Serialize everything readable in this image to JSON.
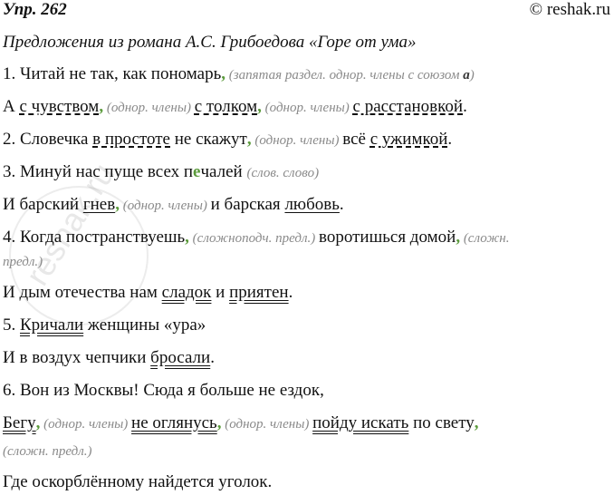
{
  "header": {
    "exercise": "Упр. 262",
    "site": "© reshak.ru"
  },
  "title": "Предложения из романа А.С. Грибоедова «Горе от ума»",
  "watermark": "reshak.ru",
  "lines": {
    "l1": {
      "a": "1. Читай не так, как пономарь",
      "c": ",",
      "n1": " (запятая раздел. однор. члены с союзом ",
      "n2": "а",
      "n3": ")"
    },
    "l2": {
      "a": "А ",
      "w1": "с чувством",
      "c1": ",",
      "n1": " (однор. члены) ",
      "w2": "с толком",
      "c2": ",",
      "n2": " (однор. члены) ",
      "w3": "с расстановкой",
      "e": "."
    },
    "l3": {
      "a": "2. Словечка ",
      "w1": "в простоте",
      "b": " не скажут",
      "c": ",",
      "n": " (однор. члены) ",
      "d": "всё ",
      "w2": "с ужимкой",
      "e": "."
    },
    "l4": {
      "a": "3. Минуй нас пуще всех п",
      "g": "е",
      "b": "чалей ",
      "n": "(слов. слово)"
    },
    "l5": {
      "a": "И барский ",
      "w1": "гнев",
      "c": ",",
      "n": " (однор. члены) ",
      "b": "и барская ",
      "w2": "любовь",
      "e": "."
    },
    "l6": {
      "a": "4. Когда постранствуешь",
      "c1": ",",
      "n1": " (сложноподч. предл.) ",
      "b": "воротишься домой",
      "c2": ",",
      "n2": " (сложн."
    },
    "l7": {
      "n": "предл.)"
    },
    "l8": {
      "a": "И дым отечества нам ",
      "w1": "сладок",
      "b": " и ",
      "w2": "приятен",
      "e": "."
    },
    "l9": {
      "a": "5. ",
      "w": "Кричали",
      "b": " женщины «ура»"
    },
    "l10": {
      "a": "И в воздух чепчики ",
      "w": "бросали",
      "e": "."
    },
    "l11": {
      "a": "6. Вон из Москвы! Сюда я больше не ездок,"
    },
    "l12": {
      "w1": "Бегу",
      "c1": ",",
      "n1": " (однор. члены) ",
      "w2": "не оглянусь",
      "c2": ",",
      "n2": " (однор. члены) ",
      "w3": "пойду искать",
      "b": " по свету",
      "c3": ","
    },
    "l13": {
      "n": "(сложн. предл.)"
    },
    "l14": {
      "a": "Где оскорблённому найдется уголок."
    }
  }
}
